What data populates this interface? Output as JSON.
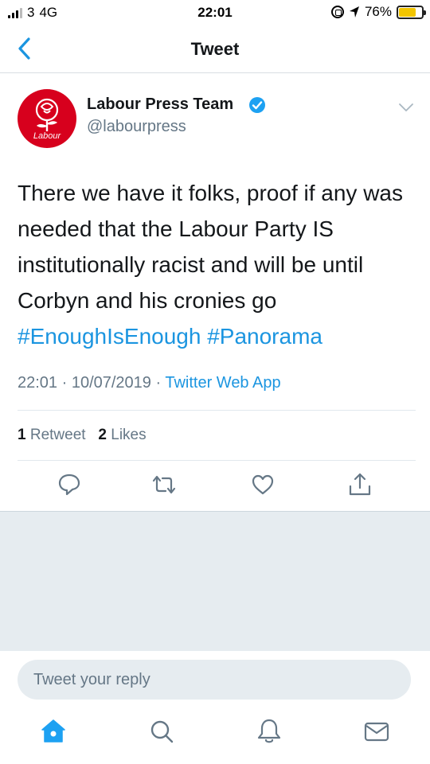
{
  "status_bar": {
    "carrier": "3",
    "network": "4G",
    "time": "22:01",
    "battery": "76%",
    "battery_level": 0.76
  },
  "header": {
    "title": "Tweet"
  },
  "tweet": {
    "author_name": "Labour Press Team",
    "author_handle": "@labourpress",
    "avatar_label": "Labour",
    "text_lines": [
      "There we have it folks, proof if any was",
      "needed that the Labour Party IS",
      "institutionally racist and will be until",
      "Corbyn and his cronies go"
    ],
    "hashtags": [
      "#EnoughIsEnough",
      "#Panorama"
    ],
    "timestamp": "22:01 · 10/07/2019 ·",
    "source": "Twitter Web App",
    "retweet_count": "1",
    "retweet_label": "Retweet",
    "like_count": "2",
    "like_label": "Likes"
  },
  "reply": {
    "placeholder": "Tweet your reply"
  },
  "colors": {
    "accent": "#1b95e0",
    "labour_red": "#d7001d"
  }
}
